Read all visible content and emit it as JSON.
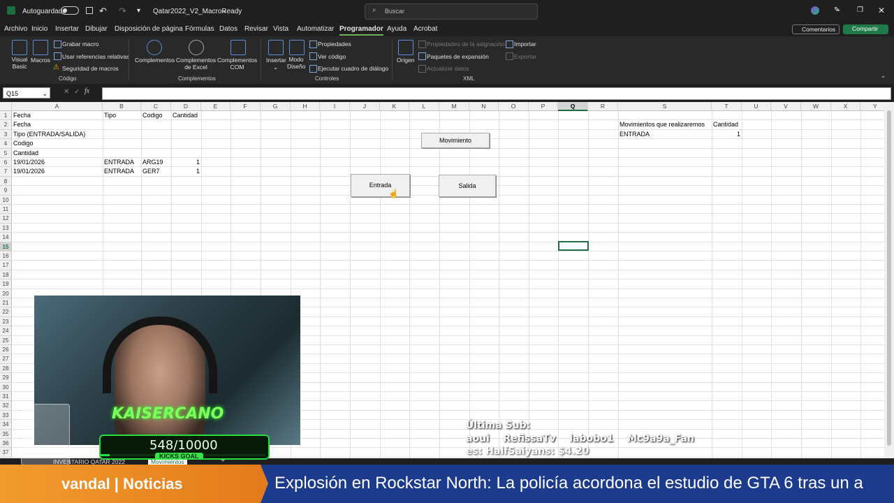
{
  "titlebar": {
    "autosave_label": "Autoguardado",
    "file_name": "Qatar2022_V2_MacroReady",
    "search_placeholder": "Buscar"
  },
  "menu": {
    "items": [
      "Archivo",
      "Inicio",
      "Insertar",
      "Dibujar",
      "Disposición de página",
      "Fórmulas",
      "Datos",
      "Revisar",
      "Vista",
      "Automatizar",
      "Programador",
      "Ayuda",
      "Acrobat"
    ],
    "active": "Programador",
    "comments_label": "Comentarios",
    "share_label": "Compartir"
  },
  "ribbon": {
    "codigo": {
      "visual_basic": "Visual Basic",
      "macros": "Macros",
      "record_macro": "Grabar macro",
      "relative_refs": "Usar referencias relativas",
      "macro_security": "Seguridad de macros",
      "group_label": "Código"
    },
    "complementos": {
      "complementos": "Complementos",
      "excel_addins": "Complementos de Excel",
      "com_addins": "Complementos COM",
      "group_label": "Complementos"
    },
    "controles": {
      "insert": "Insertar",
      "design_mode": "Modo Diseño",
      "properties": "Propiedades",
      "view_code": "Ver código",
      "run_dialog": "Ejecutar cuadro de diálogo",
      "group_label": "Controles"
    },
    "xml": {
      "source": "Origen",
      "map_properties": "Propiedades de la asignación",
      "expansion_packs": "Paquetes de expansión",
      "refresh_data": "Actualizar datos",
      "import": "Importar",
      "export": "Exportar",
      "group_label": "XML"
    }
  },
  "formula_bar": {
    "name_box": "Q15",
    "formula": ""
  },
  "grid": {
    "columns": [
      "A",
      "B",
      "C",
      "D",
      "E",
      "F",
      "G",
      "H",
      "I",
      "J",
      "K",
      "L",
      "M",
      "N",
      "O",
      "P",
      "Q",
      "R",
      "S",
      "T",
      "U",
      "V",
      "W",
      "X",
      "Y"
    ],
    "selected_column": "Q",
    "selected_row": "15",
    "cells": {
      "A1": "Fecha",
      "B1": "Tipo",
      "C1": "Codigo",
      "D1": "Cantidad",
      "A2": "Fecha",
      "A3": "Tipo (ENTRADA/SALIDA)",
      "A4": "Codigo",
      "A5": "Cantidad",
      "A6": "19/01/2026",
      "B6": "ENTRADA",
      "C6": "ARG19",
      "D6": "1",
      "A7": "19/01/2026",
      "B7": "ENTRADA",
      "C7": "GER7",
      "D7": "1",
      "S2": "Movimientos que realizaremos",
      "T2": "Cantidad",
      "S3": "ENTRADA",
      "T3": "1"
    },
    "buttons": {
      "movimiento": "Movimiento",
      "entrada": "Entrada",
      "salida": "Salida"
    }
  },
  "sheet_tabs": {
    "tab1": "INVENTARIO QATAR 2022",
    "tab2": "Movimientos"
  },
  "overlay": {
    "streamer_name": "KAISERCANO",
    "goal_progress": "548/10000",
    "goal_label": "KICKS GOAL",
    "last_sub_title": "Última Sub:",
    "subs_line": "aoui    RefissaTv    labobo1    Mc9a9a_Fan",
    "donation_line": "es: HalfSaiyans: $4.20"
  },
  "ticker": {
    "source": "vandal | Noticias",
    "headline": "Explosión en Rockstar North: La policía acordona el estudio de GTA 6 tras un a"
  },
  "colors": {
    "excel_green": "#1d6f42",
    "ticker_blue": "#1c3b8c",
    "ticker_orange": "#f29b2e",
    "goal_green": "#27e03d"
  }
}
